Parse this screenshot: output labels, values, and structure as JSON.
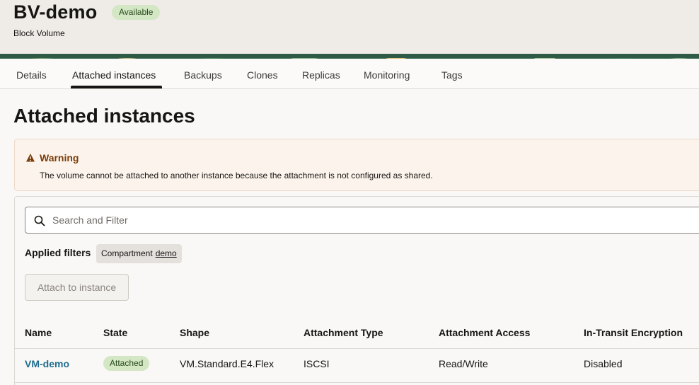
{
  "header": {
    "title": "BV-demo",
    "status": "Available",
    "subtitle": "Block Volume"
  },
  "tabs": [
    {
      "label": "Details"
    },
    {
      "label": "Attached instances",
      "active": true
    },
    {
      "label": "Backups"
    },
    {
      "label": "Clones"
    },
    {
      "label": "Replicas"
    },
    {
      "label": "Monitoring"
    },
    {
      "label": "Tags"
    }
  ],
  "page_title": "Attached instances",
  "warning": {
    "title": "Warning",
    "text": "The volume cannot be attached to another instance because the attachment is not configured as shared."
  },
  "search": {
    "placeholder": "Search and Filter",
    "value": ""
  },
  "filters": {
    "label": "Applied filters",
    "chip": {
      "key": "Compartment",
      "value": "demo"
    }
  },
  "attach_button": "Attach to instance",
  "table": {
    "columns": [
      "Name",
      "State",
      "Shape",
      "Attachment Type",
      "Attachment Access",
      "In-Transit Encryption"
    ],
    "rows": [
      {
        "name": "VM-demo",
        "state": "Attached",
        "shape": "VM.Standard.E4.Flex",
        "attachment_type": "ISCSI",
        "attachment_access": "Read/Write",
        "encryption": "Disabled"
      }
    ]
  },
  "colors": {
    "accent_link": "#1e6b8f",
    "success_badge": "#d3e7c4",
    "warning_title": "#7a3d0a",
    "warning_bg": "#fcf4ec"
  },
  "icons": {
    "warning": "warning-triangle-icon",
    "search": "search-icon"
  }
}
